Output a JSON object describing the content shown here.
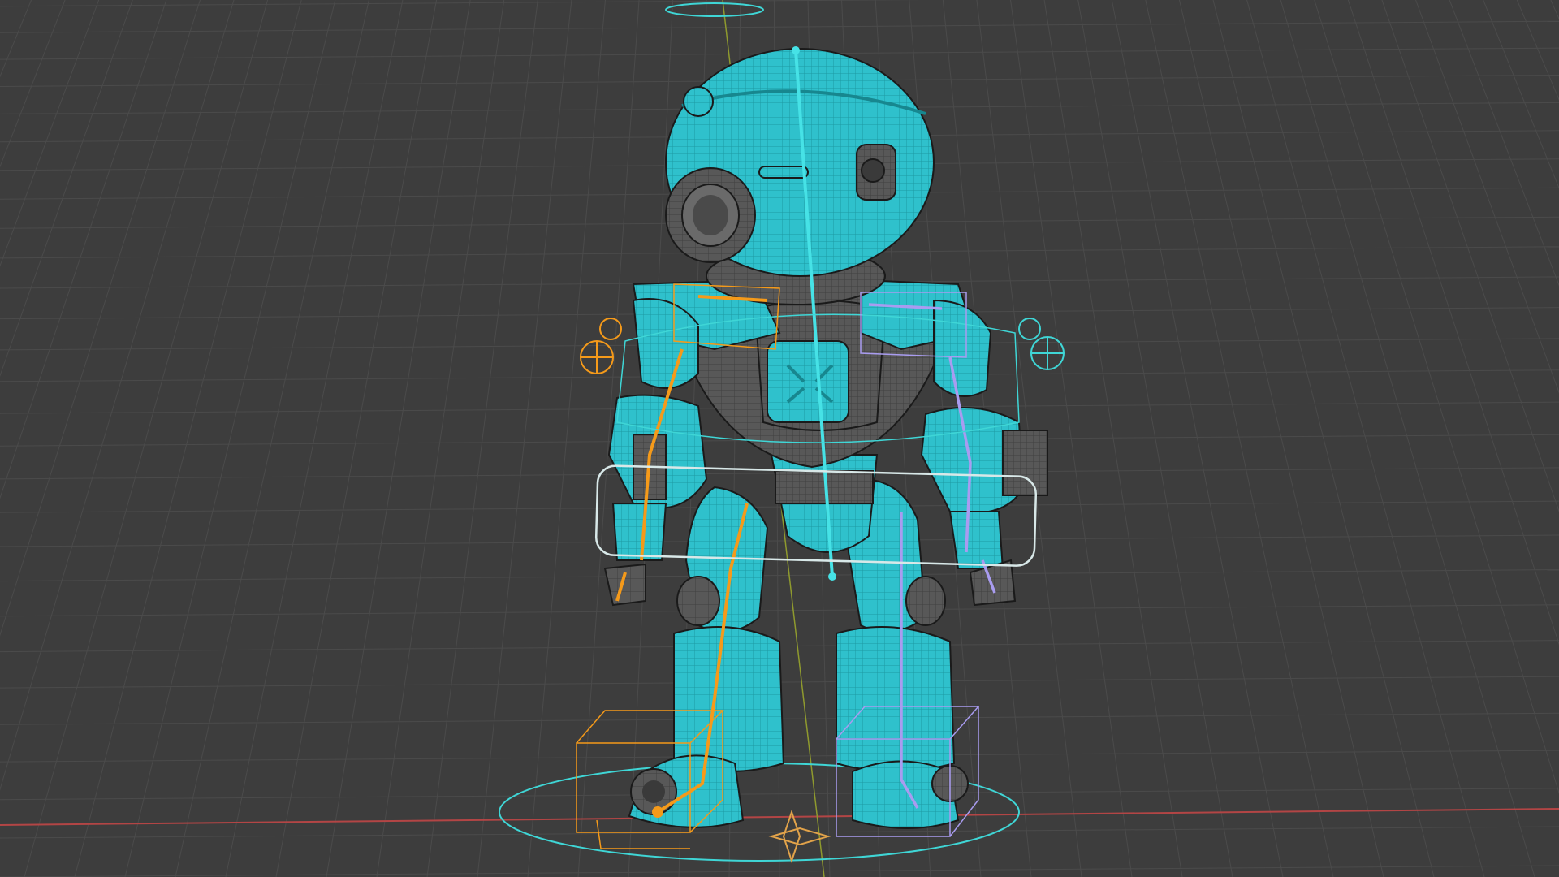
{
  "viewport": {
    "kind": "3d-viewport",
    "background": "#3d3d3d",
    "grid_color": "#4b4b4b",
    "x_axis_color": "#b34545",
    "y_axis_color": "#8f9a2e"
  },
  "colors": {
    "mesh": "#2fc1cc",
    "mesh_dark": "#17878f",
    "mesh_lines": "#1e9aa3",
    "joints": "#5a5a5a",
    "joints_dark": "#3a3a3a",
    "armature_center": "#46e2e6",
    "armature_left": "#f59a1a",
    "armature_right": "#a99cf0",
    "control_cyan": "#3fd6d6",
    "control_white": "#d8e8e8"
  },
  "icons": {
    "root_controller": "root-controller-icon",
    "ik_target_left": "ik-target-icon",
    "ik_target_right": "ik-target-icon"
  }
}
